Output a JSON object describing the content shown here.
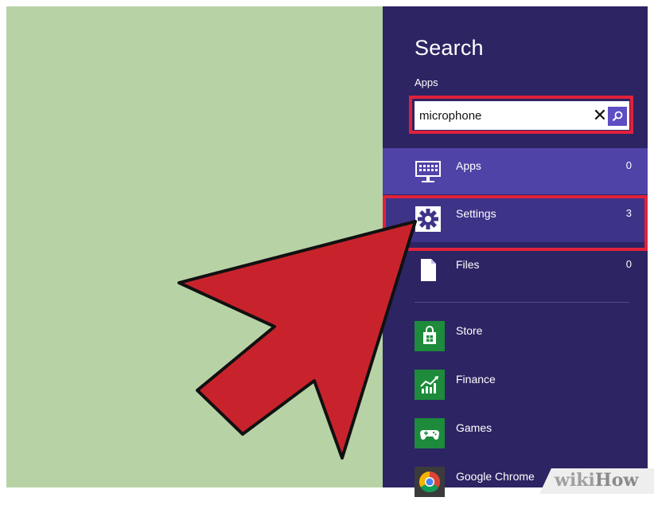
{
  "search_pane": {
    "title": "Search",
    "scope": "Apps",
    "query": "microphone",
    "clear_icon": "close-icon",
    "search_icon": "search-icon"
  },
  "categories": [
    {
      "label": "Apps",
      "count": "0",
      "icon": "keyboard-icon"
    },
    {
      "label": "Settings",
      "count": "3",
      "icon": "gear-icon"
    },
    {
      "label": "Files",
      "count": "0",
      "icon": "file-icon"
    }
  ],
  "apps": [
    {
      "label": "Store",
      "icon": "store-icon",
      "color": "#1d8b3b"
    },
    {
      "label": "Finance",
      "icon": "finance-icon",
      "color": "#1d8b3b"
    },
    {
      "label": "Games",
      "icon": "games-icon",
      "color": "#1d8b3b"
    },
    {
      "label": "Google Chrome",
      "icon": "chrome-icon",
      "color": "#3b3b3b"
    }
  ],
  "watermark": {
    "prefix": "wiki",
    "suffix": "How"
  },
  "colors": {
    "charm_bg": "#2d2463",
    "selected_row": "#4f43a8",
    "highlight": "#e0213b",
    "arrow": "#c8232c",
    "background": "#b7d3a6"
  }
}
